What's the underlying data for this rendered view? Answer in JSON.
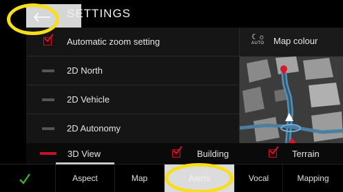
{
  "header": {
    "title": "SETTINGS",
    "back_icon": "arrow-left-icon"
  },
  "list": {
    "items": [
      {
        "label": "Automatic zoom setting",
        "checked": true
      },
      {
        "label": "2D North",
        "selected": false
      },
      {
        "label": "2D Vehicle",
        "selected": false
      },
      {
        "label": "2D Autonomy",
        "selected": false
      }
    ]
  },
  "map_colour": {
    "icon_text": "☾☼",
    "icon_subtext": "AUTO",
    "label": "Map colour"
  },
  "view_options": {
    "view_3d_label": "3D View",
    "view_3d_selected": true,
    "building_label": "Building",
    "building_checked": true,
    "terrain_label": "Terrain",
    "terrain_checked": true
  },
  "tabs": [
    {
      "label": "Aspect",
      "active": true
    },
    {
      "label": "Map",
      "active": false
    },
    {
      "label": "Alerts",
      "active": false,
      "highlighted": true
    },
    {
      "label": "Vocal",
      "active": false
    },
    {
      "label": "Mapping",
      "active": false
    }
  ],
  "colors": {
    "accent_red": "#c41424",
    "confirm_green": "#3fae2a",
    "annotation_yellow": "#f7dd1a"
  }
}
